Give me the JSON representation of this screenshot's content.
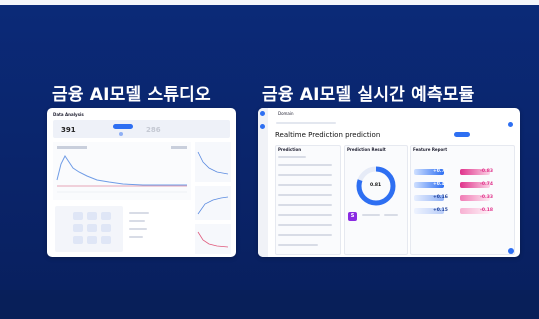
{
  "headings": {
    "left": "금융 AI모델 스튜디오",
    "right": "금융 AI모델 실시간 예측모듈"
  },
  "studio": {
    "app_title": "Data Analysis",
    "stat_main": "391",
    "stat_secondary": "286"
  },
  "realtime": {
    "app_tab": "Domain",
    "page_title": "Realtime Prediction prediction",
    "left_panel_title": "Prediction",
    "mid_panel_title": "Prediction Result",
    "gauge_value": "0.81",
    "right_panel_title": "Feature Report",
    "feature_pos_values": [
      "+0.77",
      "+0.48",
      "+0.16",
      "+0.15"
    ],
    "feature_neg_values": [
      "-0.83",
      "-0.74",
      "-0.33",
      "-0.18"
    ],
    "score_badge": "S"
  },
  "colors": {
    "background": "#0a246a",
    "accent": "#2e6ff2",
    "positive": "#2e6ff2",
    "negative": "#e0328b"
  }
}
